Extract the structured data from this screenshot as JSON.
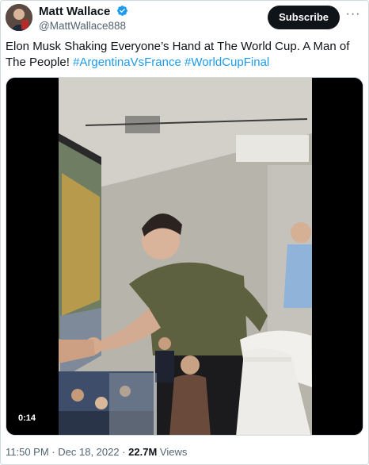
{
  "author": {
    "display_name": "Matt Wallace",
    "handle": "@MattWallace888",
    "verified": true
  },
  "actions": {
    "subscribe_label": "Subscribe",
    "more_label": "···"
  },
  "tweet": {
    "text": "Elon Musk Shaking Everyone’s Hand at The World Cup. A Man of The People!",
    "hashtags": [
      "#ArgentinaVsFrance",
      "#WorldCupFinal"
    ]
  },
  "media": {
    "type": "video",
    "duration_label": "0:14"
  },
  "meta": {
    "time": "11:50 PM",
    "separator": " · ",
    "date": "Dec 18, 2022",
    "views_count": "22.7M",
    "views_label": "Views"
  },
  "colors": {
    "link": "#1d9bf0",
    "verified": "#1d9bf0",
    "text": "#0f1419",
    "secondary": "#536471"
  }
}
